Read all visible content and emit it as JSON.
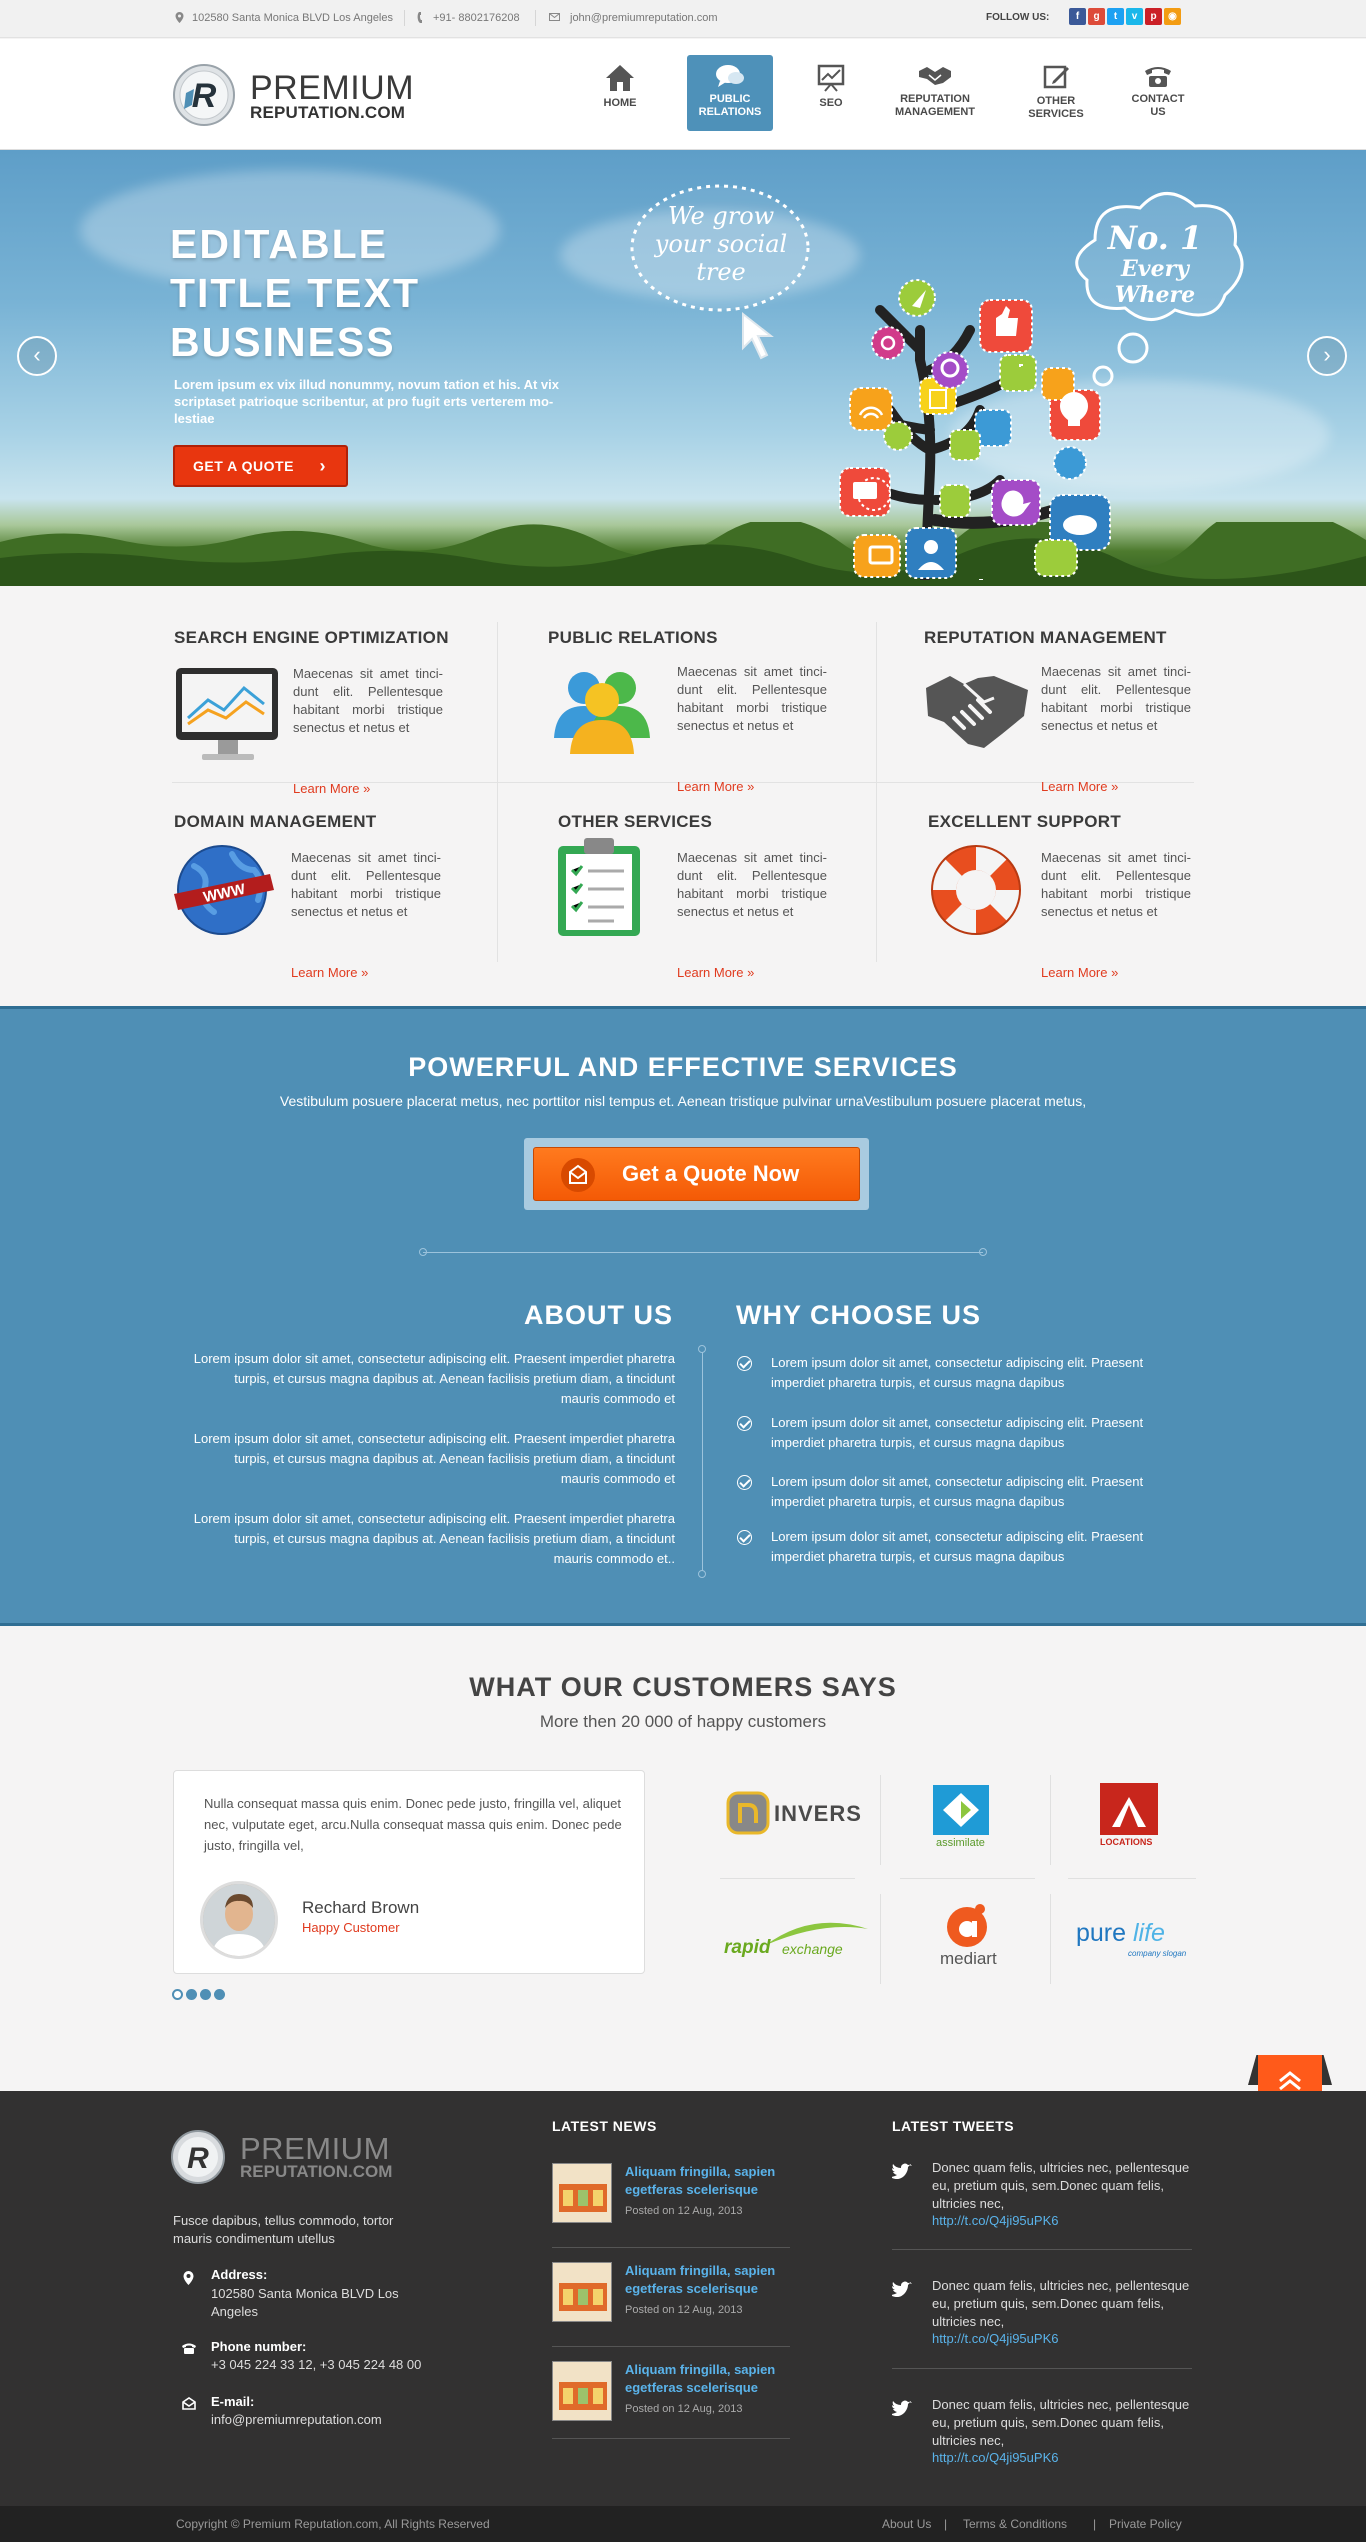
{
  "topbar": {
    "address": "102580 Santa Monica BLVD Los Angeles",
    "phone": "+91- 8802176208",
    "email": "john@premiumreputation.com",
    "follow_label": "FOLLOW US:",
    "social": [
      "facebook",
      "google-plus",
      "twitter",
      "vimeo",
      "pinterest",
      "rss"
    ]
  },
  "brand": {
    "line1": "PREMIUM",
    "line2": "REPUTATION.COM"
  },
  "nav": [
    {
      "line1": "HOME",
      "line2": "",
      "icon": "home-icon"
    },
    {
      "line1": "PUBLIC",
      "line2": "RELATIONS",
      "icon": "chat-icon",
      "active": true
    },
    {
      "line1": "SEO",
      "line2": "",
      "icon": "chart-icon"
    },
    {
      "line1": "REPUTATION",
      "line2": "MANAGEMENT",
      "icon": "handshake-icon"
    },
    {
      "line1": "OTHER",
      "line2": "SERVICES",
      "icon": "edit-icon"
    },
    {
      "line1": "CONTACT",
      "line2": "US",
      "icon": "phone-icon"
    }
  ],
  "hero": {
    "title_lines": [
      "EDITABLE",
      "TITLE TEXT",
      "BUSINESS"
    ],
    "text": "Lorem ipsum ex vix illud nonummy, novum tation et his. At vix scriptaset patrioque scribentur, at pro fugit erts verterem mo- lestiae",
    "cta": "GET A QUOTE",
    "bubble_left_lines": [
      "We grow",
      "your social",
      "tree"
    ],
    "bubble_right_lines": [
      "No. 1",
      "Every Where"
    ]
  },
  "services": [
    {
      "title": "SEARCH ENGINE OPTIMIZATION",
      "text": "Maecenas sit amet tinci- dunt elit. Pellentesque habitant morbi tristique senectus et netus et",
      "link": "Learn More »",
      "icon": "monitor-chart-icon"
    },
    {
      "title": "PUBLIC RELATIONS",
      "text": "Maecenas sit amet tinci- dunt elit. Pellentesque habitant morbi tristique senectus et netus et",
      "link": "Learn More »",
      "icon": "people-icon"
    },
    {
      "title": "REPUTATION MANAGEMENT",
      "text": "Maecenas sit amet tinci- dunt elit. Pellentesque habitant morbi tristique senectus et netus et",
      "link": "Learn More »",
      "icon": "handshake-icon"
    },
    {
      "title": "DOMAIN MANAGEMENT",
      "text": "Maecenas sit amet tinci- dunt elit. Pellentesque habitant morbi tristique senectus et netus et",
      "link": "Learn More »",
      "icon": "globe-www-icon"
    },
    {
      "title": "OTHER SERVICES",
      "text": "Maecenas sit amet tinci- dunt elit. Pellentesque habitant morbi tristique senectus et netus et",
      "link": "Learn More »",
      "icon": "clipboard-icon"
    },
    {
      "title": "EXCELLENT SUPPORT",
      "text": "Maecenas sit amet tinci- dunt elit. Pellentesque habitant morbi tristique senectus et netus et",
      "link": "Learn More »",
      "icon": "lifebuoy-icon"
    }
  ],
  "band": {
    "title": "POWERFUL AND EFFECTIVE SERVICES",
    "subtitle": "Vestibulum posuere placerat metus, nec porttitor nisl tempus et. Aenean tristique pulvinar urnaVestibulum posuere placerat metus,",
    "cta": "Get a Quote Now",
    "about_title": "ABOUT US",
    "about_paras": [
      "Lorem ipsum dolor sit amet, consectetur adipiscing elit. Praesent imperdiet pharetra turpis, et cursus magna dapibus at. Aenean facilisis pretium diam, a tincidunt mauris commodo et",
      "Lorem ipsum dolor sit amet, consectetur adipiscing elit. Praesent imperdiet pharetra turpis, et cursus magna dapibus at. Aenean facilisis pretium diam, a tincidunt mauris commodo et",
      "Lorem ipsum dolor sit amet, consectetur adipiscing elit. Praesent imperdiet pharetra turpis, et cursus magna dapibus at. Aenean facilisis pretium diam, a tincidunt mauris commodo et.."
    ],
    "why_title": "WHY CHOOSE US",
    "why_items": [
      "Lorem ipsum dolor sit amet, consectetur adipiscing elit. Praesent imperdiet pharetra turpis, et cursus magna dapibus",
      "Lorem ipsum dolor sit amet, consectetur adipiscing elit. Praesent imperdiet pharetra turpis, et cursus magna dapibus",
      "Lorem ipsum dolor sit amet, consectetur adipiscing elit. Praesent imperdiet pharetra turpis, et cursus magna dapibus",
      "Lorem ipsum dolor sit amet, consectetur adipiscing elit. Praesent imperdiet pharetra turpis, et cursus magna dapibus"
    ]
  },
  "testimonials": {
    "title": "WHAT OUR CUSTOMERS SAYS",
    "subtitle": "More then 20 000 of happy customers",
    "quote": "Nulla consequat massa quis enim. Donec pede justo, fringilla vel, aliquet nec, vulputate eget, arcu.Nulla consequat massa quis enim. Donec pede justo, fringilla vel,",
    "name": "Rechard Brown",
    "role": "Happy Customer",
    "dots": 4,
    "active_dot": 1,
    "logos": [
      {
        "name": "INVERS",
        "color": "#4a4a4a"
      },
      {
        "name": "assimilate",
        "color": "#1f9bd6"
      },
      {
        "name": "LOCATIONS",
        "color": "#c8261c"
      },
      {
        "name": "rapid",
        "sub": "exchange",
        "color": "#6aa91f"
      },
      {
        "name": "mediart",
        "color": "#ef5a1f"
      },
      {
        "name": "pure",
        "sub": "life",
        "tag": "company slogan",
        "color": "#2077c0"
      }
    ]
  },
  "footer": {
    "brand_line1": "PREMIUM",
    "brand_line2": "REPUTATION.COM",
    "about": "Fusce dapibus, tellus commodo, tortor mauris condimentum utellus",
    "address_label": "Address:",
    "address": "102580 Santa Monica BLVD Los Angeles",
    "phone_label": "Phone number:",
    "phone": "+3 045 224 33 12, +3 045 224 48 00",
    "email_label": "E-mail:",
    "email": "info@premiumreputation.com",
    "news_title": "LATEST NEWS",
    "news": [
      {
        "title": "Aliquam fringilla, sapien egetferas scelerisque",
        "date": "Posted on 12 Aug, 2013"
      },
      {
        "title": "Aliquam fringilla, sapien egetferas scelerisque",
        "date": "Posted on 12 Aug, 2013"
      },
      {
        "title": "Aliquam fringilla, sapien egetferas scelerisque",
        "date": "Posted on 12 Aug, 2013"
      }
    ],
    "tweets_title": "LATEST TWEETS",
    "tweets": [
      {
        "text": "Donec quam felis, ultricies nec, pellentesque eu, pretium quis, sem.Donec quam felis, ultricies nec,",
        "link": "http://t.co/Q4ji95uPK6"
      },
      {
        "text": "Donec quam felis, ultricies nec, pellentesque eu, pretium quis, sem.Donec quam felis, ultricies nec,",
        "link": "http://t.co/Q4ji95uPK6"
      },
      {
        "text": "Donec quam felis, ultricies nec, pellentesque eu, pretium quis, sem.Donec quam felis, ultricies nec,",
        "link": "http://t.co/Q4ji95uPK6"
      }
    ]
  },
  "bottom": {
    "copyright": "Copyright © Premium Reputation.com, All Rights Reserved",
    "links": [
      "About Us",
      "Terms & Conditions",
      "Private Policy"
    ]
  },
  "colors": {
    "accent": "#ff6a13",
    "blue": "#4f8fb5",
    "link": "#e03b1f",
    "footer": "#323131"
  }
}
